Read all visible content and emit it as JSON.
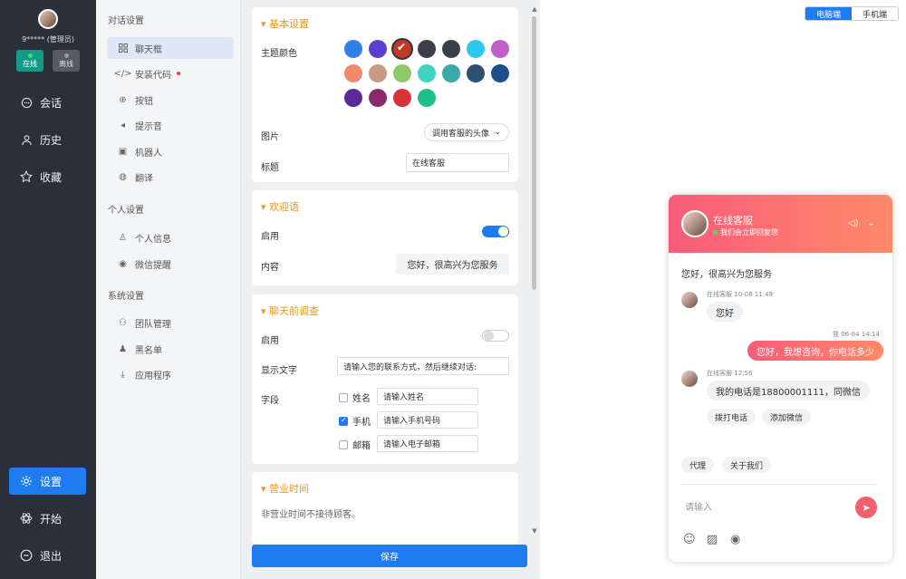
{
  "sidebar": {
    "user_name": "9***** (管理员)",
    "status_online": "在线",
    "status_offline": "离线",
    "nav": [
      {
        "label": "会话",
        "icon": "chat-bubble-icon"
      },
      {
        "label": "历史",
        "icon": "person-icon"
      },
      {
        "label": "收藏",
        "icon": "star-icon"
      },
      {
        "label": "设置",
        "icon": "gear-icon",
        "active": true
      },
      {
        "label": "开始",
        "icon": "atom-icon"
      },
      {
        "label": "退出",
        "icon": "minus-circle-icon"
      }
    ]
  },
  "submenu": {
    "groups": [
      {
        "title": "对话设置",
        "items": [
          "聊天框",
          "安装代码",
          "按钮",
          "提示音",
          "机器人",
          "翻译"
        ]
      },
      {
        "title": "个人设置",
        "items": [
          "个人信息",
          "微信提醒"
        ]
      },
      {
        "title": "系统设置",
        "items": [
          "团队管理",
          "黑名单",
          "应用程序"
        ]
      }
    ]
  },
  "basic": {
    "title": "基本设置",
    "theme_label": "主题颜色",
    "colors": [
      "#2f7fe8",
      "#5b3fd0",
      "#c0392b",
      "#3a3f4b",
      "#3a3f4b",
      "#2ec7f0",
      "#c15fc6",
      "#f08a6a",
      "#c79a84",
      "#8dc86a",
      "#3fd6c1",
      "#3aa9a8",
      "#2f4f6f",
      "#1f4f8f",
      "#5b2a9a",
      "#8a2a6a",
      "#d6333a",
      "#1fbf8a"
    ],
    "image_label": "图片",
    "image_value": "调用客服的头像",
    "title_label": "标题",
    "title_value": "在线客服"
  },
  "welcome": {
    "title": "欢迎语",
    "enable_label": "启用",
    "content_label": "内容",
    "content_value": "您好，很高兴为您服务"
  },
  "survey": {
    "title": "聊天前调查",
    "enable_label": "启用",
    "display_label": "显示文字",
    "display_value": "请输入您的联系方式，然后继续对话:",
    "fields_label": "字段",
    "fields": [
      {
        "name": "姓名",
        "placeholder": "请输入姓名",
        "checked": false
      },
      {
        "name": "手机",
        "placeholder": "请输入手机号码",
        "checked": true
      },
      {
        "name": "邮箱",
        "placeholder": "请输入电子邮箱",
        "checked": false
      }
    ]
  },
  "hours": {
    "title": "营业时间",
    "text": "非营业时间不接待顾客。"
  },
  "save_label": "保存",
  "device_toggle": {
    "desktop": "电脑端",
    "mobile": "手机端"
  },
  "chat": {
    "title": "在线客服",
    "subtitle": "我们会立即回复您",
    "welcome": "您好，很高兴为您服务",
    "agent_name": "在线客服",
    "time1": "10-08 11:49",
    "msg1": "您好",
    "visitor_meta": "我 06-04 14:14",
    "msg2": "您好，我想咨询，你电话多少",
    "time2": "12:56",
    "msg3": "我的电话是18800001111，同微信",
    "action1": "拨打电话",
    "action2": "添加微信",
    "quick1": "代理",
    "quick2": "关于我们",
    "input_placeholder": "请输入"
  }
}
